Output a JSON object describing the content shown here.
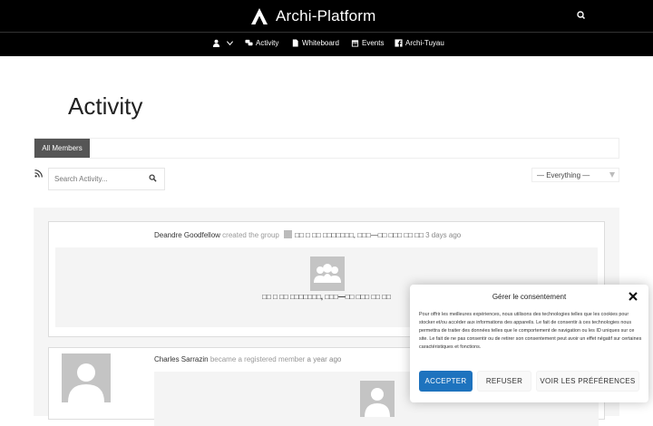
{
  "header": {
    "site_title": "Archi-Platform",
    "search_icon": "search-icon"
  },
  "nav": {
    "items": [
      {
        "label": "",
        "icon": "user-icon"
      },
      {
        "label": "Activity",
        "icon": "comments-icon"
      },
      {
        "label": "Whiteboard",
        "icon": "document-icon"
      },
      {
        "label": "Events",
        "icon": "calendar-icon"
      },
      {
        "label": "Archi-Tuyau",
        "icon": "facebook-icon"
      }
    ]
  },
  "page": {
    "title": "Activity",
    "tab_all_members": "All Members",
    "search_placeholder": "Search Activity...",
    "filter_value": "— Everything —"
  },
  "activities": [
    {
      "user": "Deandre Goodfellow",
      "action": "created the group",
      "group_name": "□□ □ □□ □□□□□□□, □□□—□□ □□□ □□ □□",
      "time": "3 days ago"
    },
    {
      "user": "Charles Sarrazin",
      "action": "became a registered member",
      "time": "a year ago"
    }
  ],
  "consent": {
    "title": "Gérer le consentement",
    "body": "Pour offrir les meilleures expériences, nous utilisons des technologies telles que les cookies pour stocker et/ou accéder aux informations des appareils. Le fait de consentir à ces technologies nous permettra de traiter des données telles que le comportement de navigation ou les ID uniques sur ce site. Le fait de ne pas consentir ou de retirer son consentement peut avoir un effet négatif sur certaines caractéristiques et fonctions.",
    "accept": "ACCEPTER",
    "refuse": "REFUSER",
    "preferences": "VOIR LES PRÉFÉRENCES"
  },
  "colors": {
    "header_bg": "#000000",
    "accent": "#1e73be"
  }
}
